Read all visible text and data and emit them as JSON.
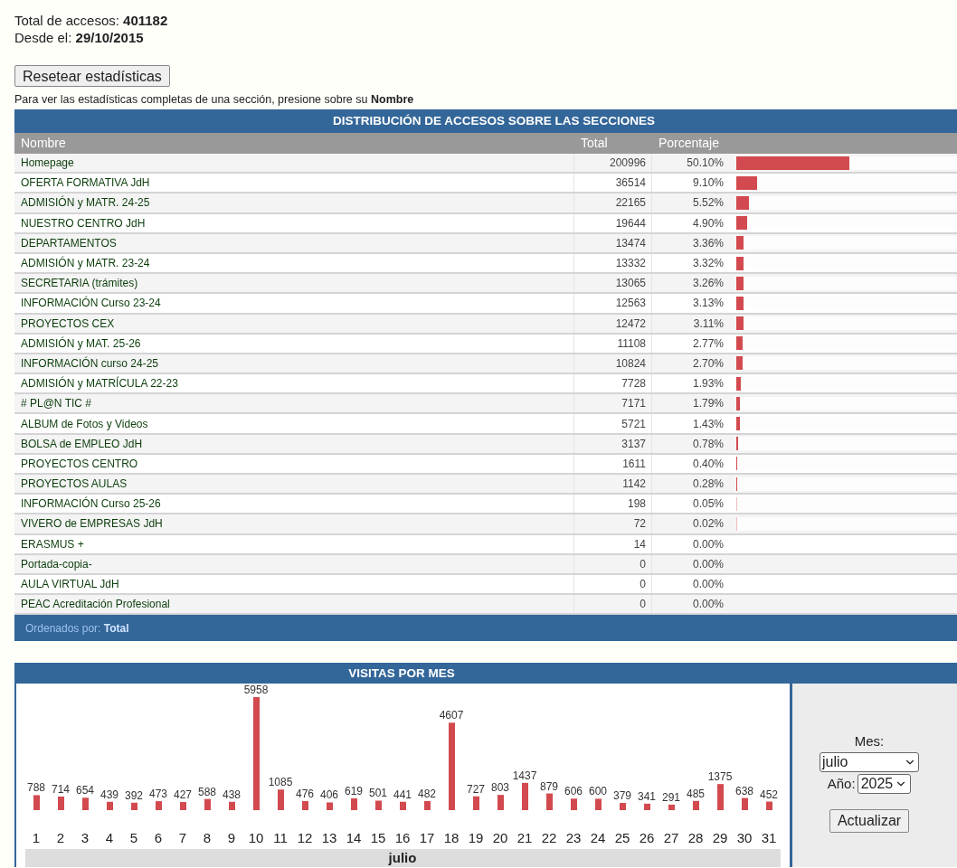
{
  "summary": {
    "total_label": "Total de accesos:",
    "total": "401182",
    "since_label": "Desde el:",
    "since": "29/10/2015"
  },
  "reset_button": "Resetear estadísticas",
  "hint": "Para ver las estadísticas completas de una sección, presione sobre su **Nombre**",
  "sections_table": {
    "title": "DISTRIBUCIÓN DE ACCESOS SOBRE LAS SECCIONES",
    "columns": [
      "Nombre",
      "Total",
      "Porcentaje"
    ],
    "rows": [
      {
        "name": "Homepage",
        "total": "200996",
        "percent": "50.10%",
        "level": 0.501
      },
      {
        "name": "OFERTA FORMATIVA JdH",
        "total": "36514",
        "percent": "9.10%",
        "level": 0.091
      },
      {
        "name": "ADMISIÓN y MATR. 24-25",
        "total": "22165",
        "percent": "5.52%",
        "level": 0.0552
      },
      {
        "name": "NUESTRO CENTRO JdH",
        "total": "19644",
        "percent": "4.90%",
        "level": 0.049
      },
      {
        "name": "DEPARTAMENTOS",
        "total": "13474",
        "percent": "3.36%",
        "level": 0.0336
      },
      {
        "name": "ADMISIÓN y MATR. 23-24",
        "total": "13332",
        "percent": "3.32%",
        "level": 0.0332
      },
      {
        "name": "SECRETARIA (trámites)",
        "total": "13065",
        "percent": "3.26%",
        "level": 0.0326
      },
      {
        "name": "INFORMACIÓN Curso 23-24",
        "total": "12563",
        "percent": "3.13%",
        "level": 0.0313
      },
      {
        "name": "PROYECTOS CEX",
        "total": "12472",
        "percent": "3.11%",
        "level": 0.0311
      },
      {
        "name": "ADMISIÓN y MAT. 25-26",
        "total": "11108",
        "percent": "2.77%",
        "level": 0.0277
      },
      {
        "name": "INFORMACIÓN curso 24-25",
        "total": "10824",
        "percent": "2.70%",
        "level": 0.027
      },
      {
        "name": "ADMISIÓN y MATRÍCULA 22-23",
        "total": "7728",
        "percent": "1.93%",
        "level": 0.0193
      },
      {
        "name": "# PL@N TIC #",
        "total": "7171",
        "percent": "1.79%",
        "level": 0.0179
      },
      {
        "name": "ALBUM de Fotos y Videos",
        "total": "5721",
        "percent": "1.43%",
        "level": 0.0143
      },
      {
        "name": "BOLSA de EMPLEO JdH",
        "total": "3137",
        "percent": "0.78%",
        "level": 0.0078
      },
      {
        "name": "PROYECTOS CENTRO",
        "total": "1611",
        "percent": "0.40%",
        "level": 0.004
      },
      {
        "name": "PROYECTOS AULAS",
        "total": "1142",
        "percent": "0.28%",
        "level": 0.0028
      },
      {
        "name": "INFORMACIÓN Curso 25-26",
        "total": "198",
        "percent": "0.05%",
        "level": 0.0005
      },
      {
        "name": "VIVERO de EMPRESAS JdH",
        "total": "72",
        "percent": "0.02%",
        "level": 0.0002
      },
      {
        "name": "ERASMUS +",
        "total": "14",
        "percent": "0.00%"
      },
      {
        "name": "Portada-copia-",
        "total": "0",
        "percent": "0.00%"
      },
      {
        "name": "AULA VIRTUAL JdH",
        "total": "0",
        "percent": "0.00%"
      },
      {
        "name": "PEAC Acreditación Profesional",
        "total": "0",
        "percent": "0.00%"
      }
    ],
    "footer_label": "Ordenados por:",
    "footer_value": "Total"
  },
  "monthly": {
    "title": "VISITAS POR MES",
    "chart_data": {
      "type": "bar",
      "xlabel": "julio",
      "data_labels": true,
      "categories": [
        "1",
        "2",
        "3",
        "4",
        "5",
        "6",
        "7",
        "8",
        "9",
        "10",
        "11",
        "12",
        "13",
        "14",
        "15",
        "16",
        "17",
        "18",
        "19",
        "20",
        "21",
        "22",
        "23",
        "24",
        "25",
        "26",
        "27",
        "28",
        "29",
        "30",
        "31"
      ],
      "series": [
        {
          "color": "#d24a4f",
          "values": [
            788,
            714,
            654,
            439,
            392,
            473,
            427,
            588,
            438,
            5958,
            1085,
            476,
            406,
            619,
            501,
            441,
            482,
            4607,
            727,
            803,
            1437,
            879,
            606,
            600,
            379,
            341,
            291,
            485,
            1375,
            638,
            452
          ]
        }
      ]
    },
    "month_label": "Mes:",
    "month": "julio",
    "year_label": "Año:",
    "year": "2025",
    "update_button": "Actualizar"
  }
}
